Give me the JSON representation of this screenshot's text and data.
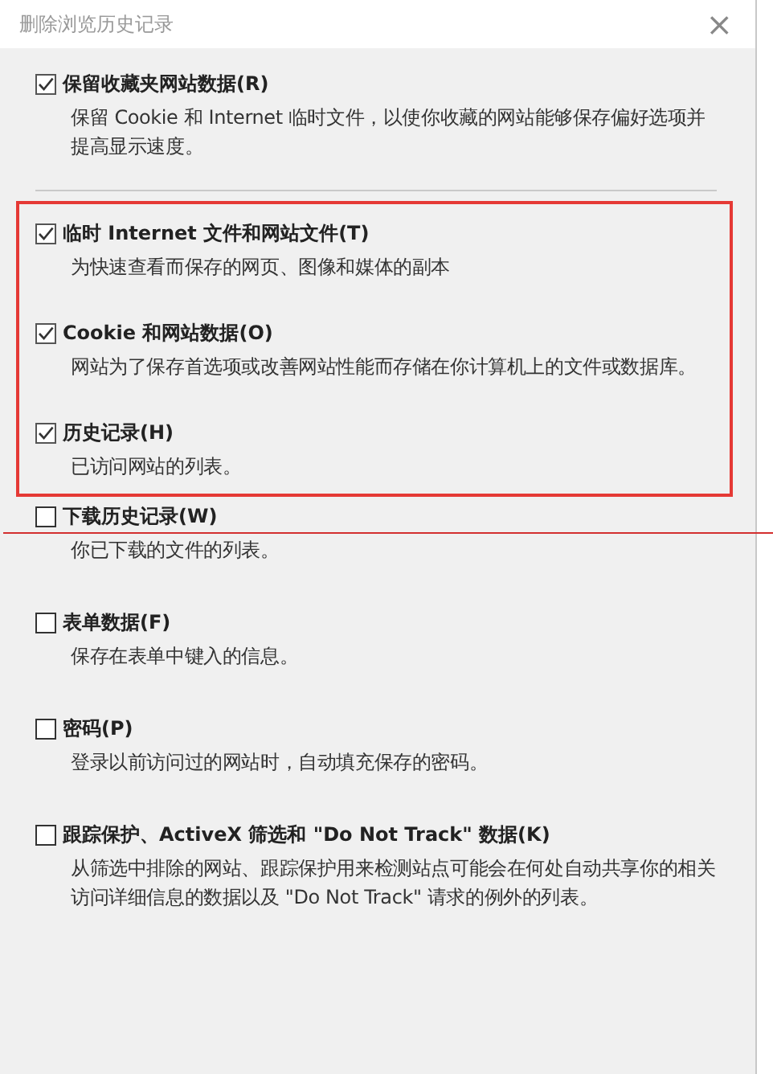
{
  "window": {
    "title": "删除浏览历史记录",
    "close": "×"
  },
  "items": [
    {
      "label": "保留收藏夹网站数据(R)",
      "description": "保留 Cookie 和 Internet 临时文件，以使你收藏的网站能够保存偏好选项并提高显示速度。",
      "checked": true,
      "highlighted": false,
      "separator_after": true,
      "red_line": false
    },
    {
      "label": "临时 Internet 文件和网站文件(T)",
      "description": "为快速查看而保存的网页、图像和媒体的副本",
      "checked": true,
      "highlighted": true,
      "separator_after": false,
      "red_line": false
    },
    {
      "label": "Cookie 和网站数据(O)",
      "description": "网站为了保存首选项或改善网站性能而存储在你计算机上的文件或数据库。",
      "checked": true,
      "highlighted": true,
      "separator_after": false,
      "red_line": false
    },
    {
      "label": "历史记录(H)",
      "description": "已访问网站的列表。",
      "checked": true,
      "highlighted": true,
      "separator_after": false,
      "red_line": false
    },
    {
      "label": "下载历史记录(W)",
      "description": "你已下载的文件的列表。",
      "checked": false,
      "highlighted": false,
      "separator_after": false,
      "red_line": true
    },
    {
      "label": "表单数据(F)",
      "description": "保存在表单中键入的信息。",
      "checked": false,
      "highlighted": false,
      "separator_after": false,
      "red_line": false
    },
    {
      "label": "密码(P)",
      "description": "登录以前访问过的网站时，自动填充保存的密码。",
      "checked": false,
      "highlighted": false,
      "separator_after": false,
      "red_line": false
    },
    {
      "label": "跟踪保护、ActiveX 筛选和 \"Do Not Track\" 数据(K)",
      "description": "从筛选中排除的网站、跟踪保护用来检测站点可能会在何处自动共享你的相关访问详细信息的数据以及 \"Do Not Track\" 请求的例外的列表。",
      "checked": false,
      "highlighted": false,
      "separator_after": false,
      "red_line": false
    }
  ]
}
